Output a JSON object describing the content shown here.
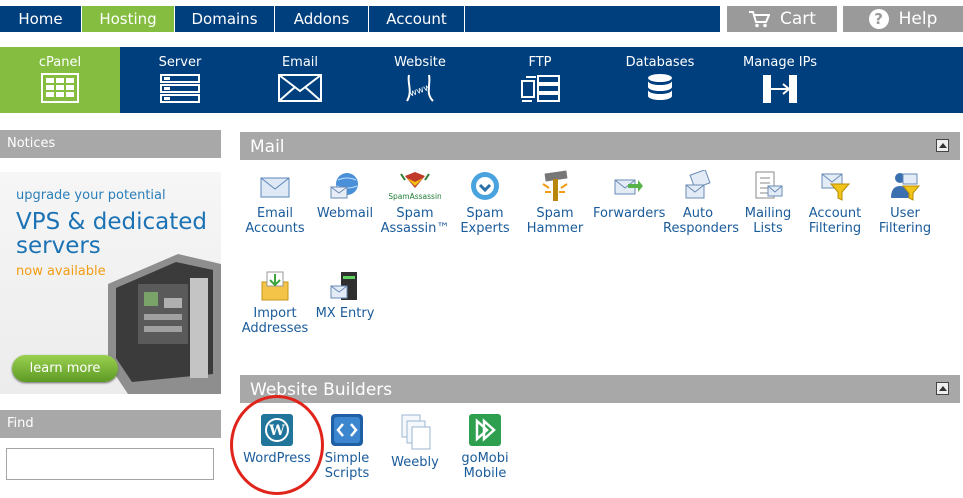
{
  "topnav": {
    "tabs": [
      {
        "label": "Home",
        "active": false
      },
      {
        "label": "Hosting",
        "active": true
      },
      {
        "label": "Domains",
        "active": false
      },
      {
        "label": "Addons",
        "active": false
      },
      {
        "label": "Account",
        "active": false
      }
    ],
    "cart_label": "Cart",
    "help_label": "Help",
    "help_glyph": "?"
  },
  "subnav": {
    "items": [
      {
        "label": "cPanel",
        "icon": "cpanel-icon",
        "active": true
      },
      {
        "label": "Server",
        "icon": "server-icon",
        "active": false
      },
      {
        "label": "Email",
        "icon": "envelope-icon",
        "active": false
      },
      {
        "label": "Website",
        "icon": "www-icon",
        "active": false
      },
      {
        "label": "FTP",
        "icon": "ftp-icon",
        "active": false
      },
      {
        "label": "Databases",
        "icon": "database-icon",
        "active": false
      },
      {
        "label": "Manage IPs",
        "icon": "ip-icon",
        "active": false
      }
    ]
  },
  "sidebar": {
    "notices_label": "Notices",
    "promo": {
      "line1": "upgrade your potential",
      "line2": "VPS & dedicated servers",
      "line3": "now available",
      "button": "learn more"
    },
    "find_label": "Find",
    "find_value": ""
  },
  "mail": {
    "title": "Mail",
    "items": [
      {
        "label": "Email Accounts",
        "icon": "email-accounts-icon"
      },
      {
        "label": "Webmail",
        "icon": "webmail-icon"
      },
      {
        "label": "Spam Assassin™",
        "icon": "spamassassin-icon",
        "logo_text": "SpamAssassin"
      },
      {
        "label": "Spam Experts",
        "icon": "spam-experts-icon"
      },
      {
        "label": "Spam Hammer",
        "icon": "spam-hammer-icon"
      },
      {
        "label": "Forwarders",
        "icon": "forwarders-icon"
      },
      {
        "label": "Auto Responders",
        "icon": "auto-responders-icon"
      },
      {
        "label": "Mailing Lists",
        "icon": "mailing-lists-icon"
      },
      {
        "label": "Account Filtering",
        "icon": "account-filtering-icon"
      },
      {
        "label": "User Filtering",
        "icon": "user-filtering-icon"
      },
      {
        "label": "Import Addresses",
        "icon": "import-addresses-icon"
      },
      {
        "label": "MX Entry",
        "icon": "mx-entry-icon"
      }
    ]
  },
  "website_builders": {
    "title": "Website Builders",
    "items": [
      {
        "label": "WordPress",
        "icon": "wordpress-icon"
      },
      {
        "label": "Simple Scripts",
        "icon": "simple-scripts-icon"
      },
      {
        "label": "Weebly",
        "icon": "weebly-icon"
      },
      {
        "label": "goMobi Mobile",
        "icon": "gomobi-icon"
      }
    ]
  },
  "colors": {
    "nav_blue": "#003f7d",
    "active_green": "#84bd3f",
    "header_gray": "#a8a8a8",
    "link_blue": "#1a5b9a",
    "highlight_red": "#e0241b"
  }
}
